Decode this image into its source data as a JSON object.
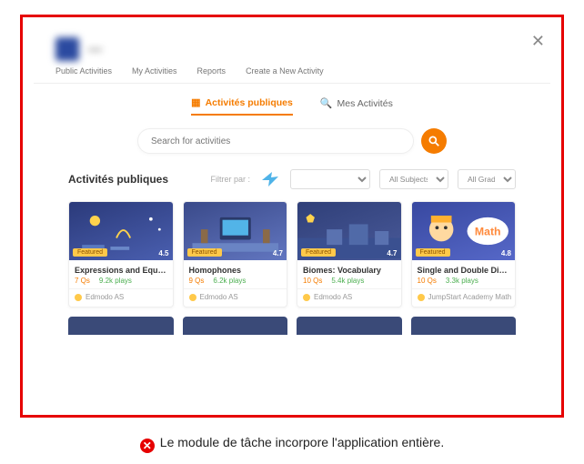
{
  "caption": {
    "text": "Le module de tâche incorpore l'application entière."
  },
  "header": {
    "title": "—"
  },
  "topnav": {
    "items": [
      "Public Activities",
      "My Activities",
      "Reports",
      "Create a New Activity"
    ]
  },
  "tabs": {
    "active": "Activités publiques",
    "other": "Mes Activités"
  },
  "search": {
    "placeholder": "Search for activities"
  },
  "filter": {
    "section_title": "Activités publiques",
    "label": "Filtrer par :",
    "sel1": "",
    "sel2": "All Subjects",
    "sel3": "All Grades"
  },
  "cards": [
    {
      "title": "Expressions and Equati…",
      "qs": "7 Qs",
      "plays": "9.2k plays",
      "author": "Edmodo AS",
      "rating": "4.5",
      "featured": "Featured"
    },
    {
      "title": "Homophones",
      "qs": "9 Qs",
      "plays": "6.2k plays",
      "author": "Edmodo AS",
      "rating": "4.7",
      "featured": "Featured"
    },
    {
      "title": "Biomes: Vocabulary",
      "qs": "10 Qs",
      "plays": "5.4k plays",
      "author": "Edmodo AS",
      "rating": "4.7",
      "featured": "Featured"
    },
    {
      "title": "Single and Double Digit…",
      "qs": "10 Qs",
      "plays": "3.3k plays",
      "author": "JumpStart Academy Math",
      "rating": "4.8",
      "featured": "Featured"
    }
  ]
}
